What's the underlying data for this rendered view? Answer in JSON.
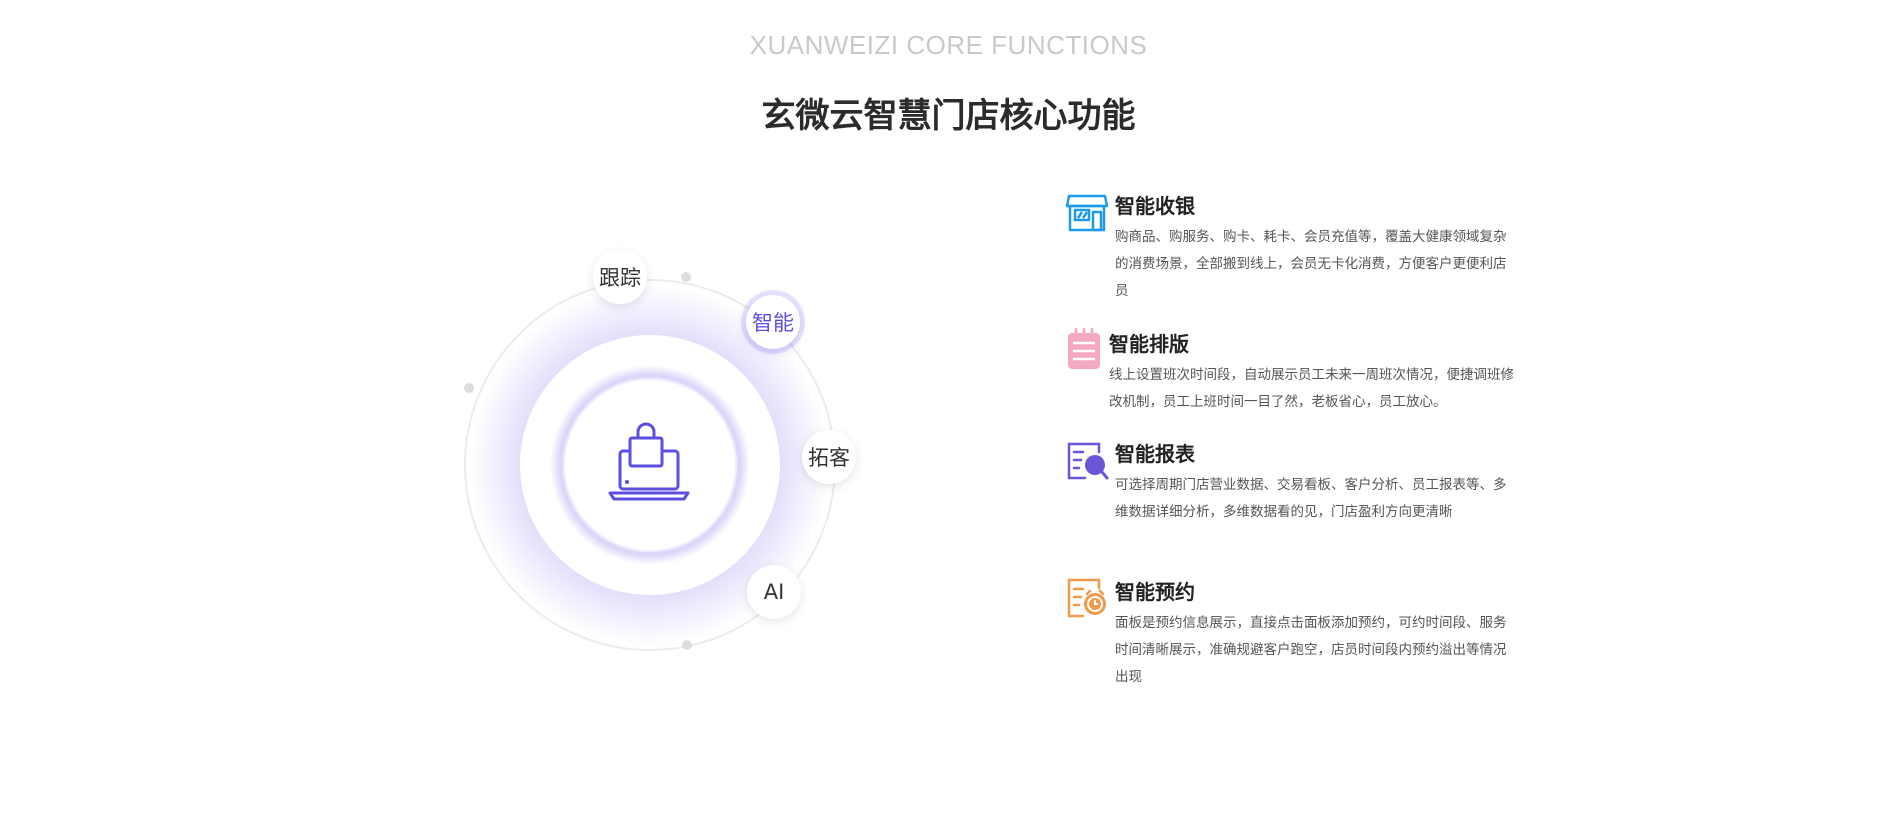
{
  "header": {
    "subtitle": "XUANWEIZI CORE FUNCTIONS",
    "title": "玄微云智慧门店核心功能"
  },
  "orbit": {
    "center_icon": "laptop-shopping-bag-icon",
    "accent_color": "#5b4fe0",
    "nodes": [
      {
        "label": "跟踪",
        "active": false
      },
      {
        "label": "智能",
        "active": true
      },
      {
        "label": "拓客",
        "active": false
      },
      {
        "label": "AI",
        "active": false
      }
    ]
  },
  "features": [
    {
      "icon": "store-icon",
      "color": "#1e9be8",
      "title": "智能收银",
      "desc": "购商品、购服务、购卡、耗卡、会员充值等，覆盖大健康领域复杂的消费场景，全部搬到线上，会员无卡化消费，方便客户更便利店员"
    },
    {
      "icon": "schedule-notepad-icon",
      "color": "#f0a3c0",
      "title": "智能排版",
      "desc": "线上设置班次时间段，自动展示员工未来一周班次情况，便捷调班修改机制，员工上班时间一目了然，老板省心，员工放心。"
    },
    {
      "icon": "report-search-icon",
      "color": "#6a55d8",
      "title": "智能报表",
      "desc": "可选择周期门店营业数据、交易看板、客户分析、员工报表等、多维数据详细分析，多维数据看的见，门店盈利方向更清晰"
    },
    {
      "icon": "appointment-clock-icon",
      "color": "#f09a4a",
      "title": "智能预约",
      "desc": "面板是预约信息展示，直接点击面板添加预约，可约时间段、服务时间清晰展示，准确规避客户跑空，店员时间段内预约溢出等情况出现"
    }
  ]
}
